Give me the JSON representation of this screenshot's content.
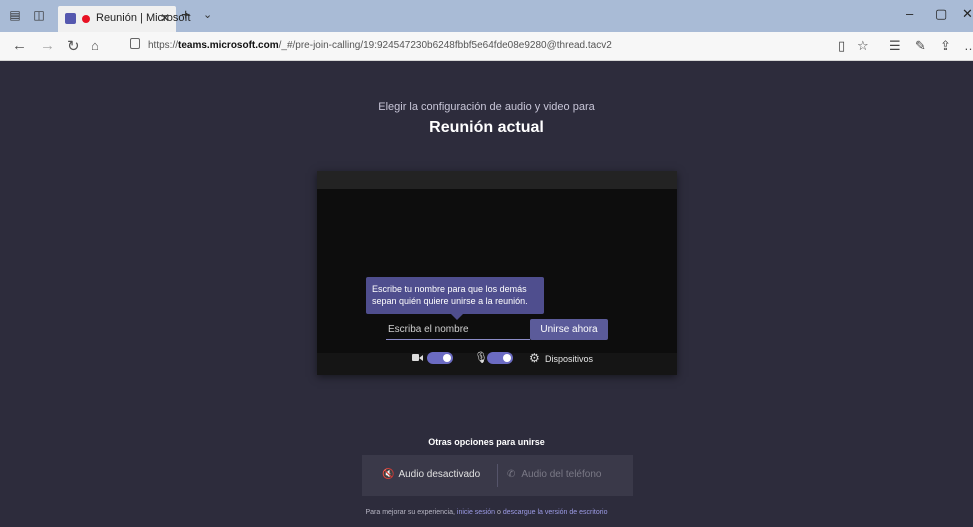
{
  "browser": {
    "tab": {
      "title": "Reunión | Microsoft",
      "close": "✕"
    },
    "new_tab": "+",
    "tab_menu": "⌄",
    "url_prefix": "https://",
    "url_domain": "teams.microsoft.com",
    "url_path": "/_#/pre-join-calling/19:924547230b6248fbbf5e64fde08e9280@thread.tacv2",
    "window": {
      "minimize": "–",
      "maximize": "▢",
      "close": "✕"
    },
    "toolbar_icons": [
      "reading-view-icon",
      "favorite-star-icon",
      "favorites-list-icon",
      "pen-icon",
      "share-icon",
      "more-icon"
    ]
  },
  "prejoin": {
    "subtitle": "Elegir la configuración de audio y video para",
    "title": "Reunión actual",
    "tooltip": "Escribe tu nombre para que los demás sepan quién quiere unirse a la reunión.",
    "name_placeholder": "Escriba el nombre",
    "join_button": "Unirse ahora",
    "camera_on": true,
    "mic_on": true,
    "devices_label": "Dispositivos"
  },
  "other_options": {
    "title": "Otras opciones para unirse",
    "audio_off": "Audio desactivado",
    "phone_audio": "Audio del teléfono"
  },
  "footer": {
    "prefix": "Para mejorar su experiencia, ",
    "sign_in": "inicie sesión",
    "middle": " o ",
    "download": "descargue la versión de escritorio"
  },
  "colors": {
    "page_bg": "#2d2c3c",
    "accent": "#6b6bc2",
    "tooltip_bg": "#4f4e8e",
    "tabbar_bg": "#a9bbd6"
  }
}
